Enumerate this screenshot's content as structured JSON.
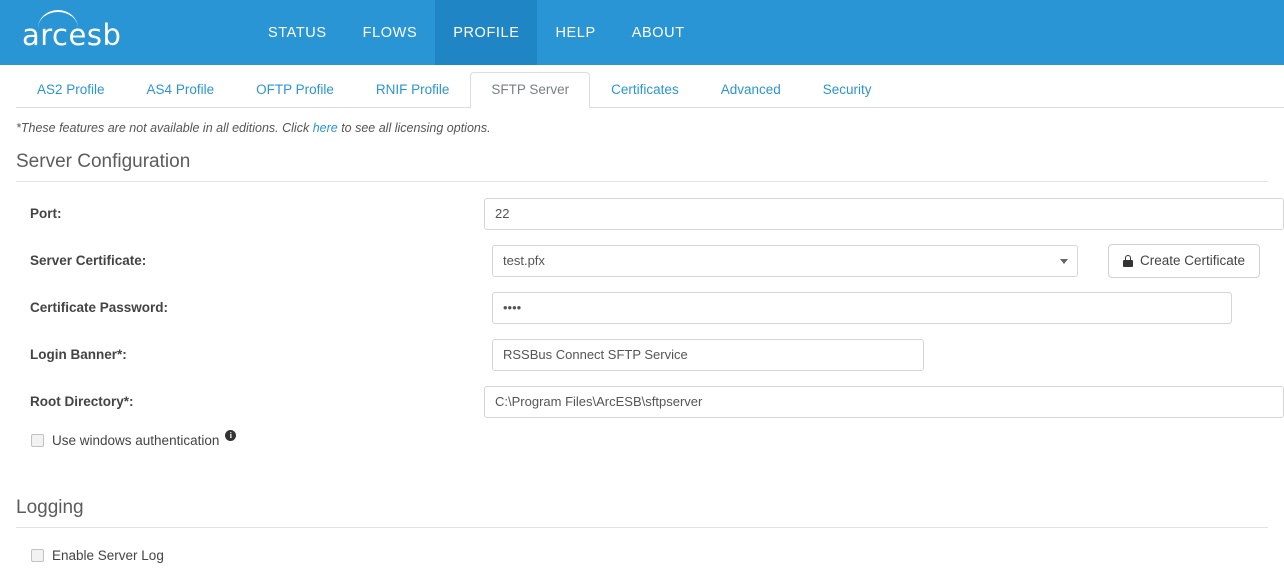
{
  "brand": {
    "name": "arcesb"
  },
  "colors": {
    "header_blue": "#2a95d5",
    "header_active_blue": "#1f85c4",
    "link_blue": "#2a95d5",
    "border_gray": "#dddddd"
  },
  "mainnav": {
    "items": [
      {
        "label": "STATUS",
        "active": false
      },
      {
        "label": "FLOWS",
        "active": false
      },
      {
        "label": "PROFILE",
        "active": true
      },
      {
        "label": "HELP",
        "active": false
      },
      {
        "label": "ABOUT",
        "active": false
      }
    ]
  },
  "tabs": {
    "items": [
      {
        "label": "AS2 Profile",
        "active": false
      },
      {
        "label": "AS4 Profile",
        "active": false
      },
      {
        "label": "OFTP Profile",
        "active": false
      },
      {
        "label": "RNIF Profile",
        "active": false
      },
      {
        "label": "SFTP Server",
        "active": true
      },
      {
        "label": "Certificates",
        "active": false
      },
      {
        "label": "Advanced",
        "active": false
      },
      {
        "label": "Security",
        "active": false
      }
    ]
  },
  "note": {
    "prefix": "*These features are not available in all editions. Click ",
    "link": "here",
    "suffix": " to see all licensing options."
  },
  "server_configuration": {
    "heading": "Server Configuration",
    "port": {
      "label": "Port:",
      "value": "22"
    },
    "server_certificate": {
      "label": "Server Certificate:",
      "value": "test.pfx",
      "button_label": "Create Certificate",
      "button_icon": "lock-icon"
    },
    "certificate_password": {
      "label": "Certificate Password:",
      "value": "••••"
    },
    "login_banner": {
      "label": "Login Banner*:",
      "value": "RSSBus Connect SFTP Service"
    },
    "root_directory": {
      "label": "Root Directory*:",
      "value": "C:\\Program Files\\ArcESB\\sftpserver"
    },
    "use_windows_authentication": {
      "label": "Use windows authentication",
      "checked": false,
      "info_icon": "info-icon",
      "info_glyph": "i"
    }
  },
  "logging": {
    "heading": "Logging",
    "enable_server_log": {
      "label": "Enable Server Log",
      "checked": false
    }
  }
}
